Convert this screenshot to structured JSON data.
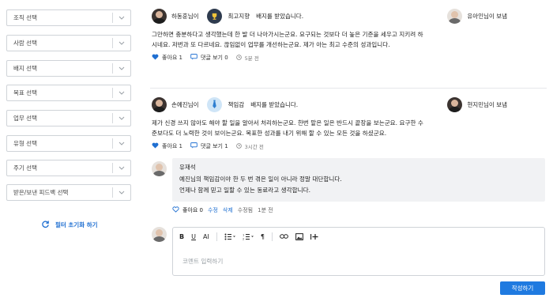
{
  "filters": {
    "selects": [
      {
        "label": "조직 선택"
      },
      {
        "label": "사람 선택"
      },
      {
        "label": "배지 선택"
      },
      {
        "label": "목표 선택"
      },
      {
        "label": "업무 선택"
      },
      {
        "label": "유형 선택"
      },
      {
        "label": "주기 선택"
      },
      {
        "label": "받은/보낸 피드백 선택"
      }
    ],
    "reset_label": "필터 초기화 하기"
  },
  "posts": [
    {
      "sender": "하동훈님이",
      "badge_name": "최고지향",
      "received_text": "배지를 받았습니다.",
      "recipient": "유아인님이 보냄",
      "body": [
        "그만하면 충분하다고 생각했는데 한 발 더 나아가시는군요. 요구되는 것보다 더 높은 기준을 세우고 지키려 하",
        "시네요. 저번과 또 다르네요. 끊임없이 업무를 개선하는군요. 제가 아는 최고 수준의 성과입니다."
      ],
      "like_label": "좋아요 1",
      "comment_label": "댓글 보기 0",
      "time": "5분 전"
    },
    {
      "sender": "손예진님이",
      "badge_name": "책임감",
      "received_text": "배지를 받았습니다.",
      "recipient": "현지민님이 보냄",
      "body": [
        "제가 신경 쓰지 않아도 해야 할 일을 알아서 처리하는군요. 한번 맡은 일은 반드시 끝장을 보는군요. 요구한 수",
        "준보다도 더 노력한 것이 보이는군요. 목표한 성과를 내기 위해 할 수 있는 모든 것을 하셨군요."
      ],
      "like_label": "좋아요 1",
      "comment_label": "댓글 보기 1",
      "time": "3시간 전"
    }
  ],
  "comment": {
    "author": "유재석",
    "lines": [
      "예진님의 책임감이야 한 두 번 겪은 일이 아니라 정말 대단합니다.",
      "언제나 함께 믿고 일할 수 있는 동료라고 생각합니다."
    ],
    "like_label": "좋아요 0",
    "edit_label": "수정",
    "delete_label": "삭제",
    "edited_label": "수정됨",
    "time": "1분 전"
  },
  "editor": {
    "toolbar": {
      "bold": "B",
      "underline": "U",
      "font_size": "AI",
      "heading": "¶"
    },
    "placeholder": "코멘트 입력하기",
    "submit_label": "작성하기"
  },
  "colors": {
    "accent": "#1f7ae0",
    "link": "#1f6fd1",
    "heart": "#1f6fd1",
    "comment_bg": "#f1f2f4"
  },
  "icons": [
    "chevron-down-icon",
    "refresh-icon",
    "trophy-icon",
    "tie-icon",
    "heart-icon",
    "comment-icon",
    "clock-icon",
    "bullet-list-icon",
    "numbered-list-icon",
    "link-icon",
    "image-icon",
    "insert-icon"
  ]
}
